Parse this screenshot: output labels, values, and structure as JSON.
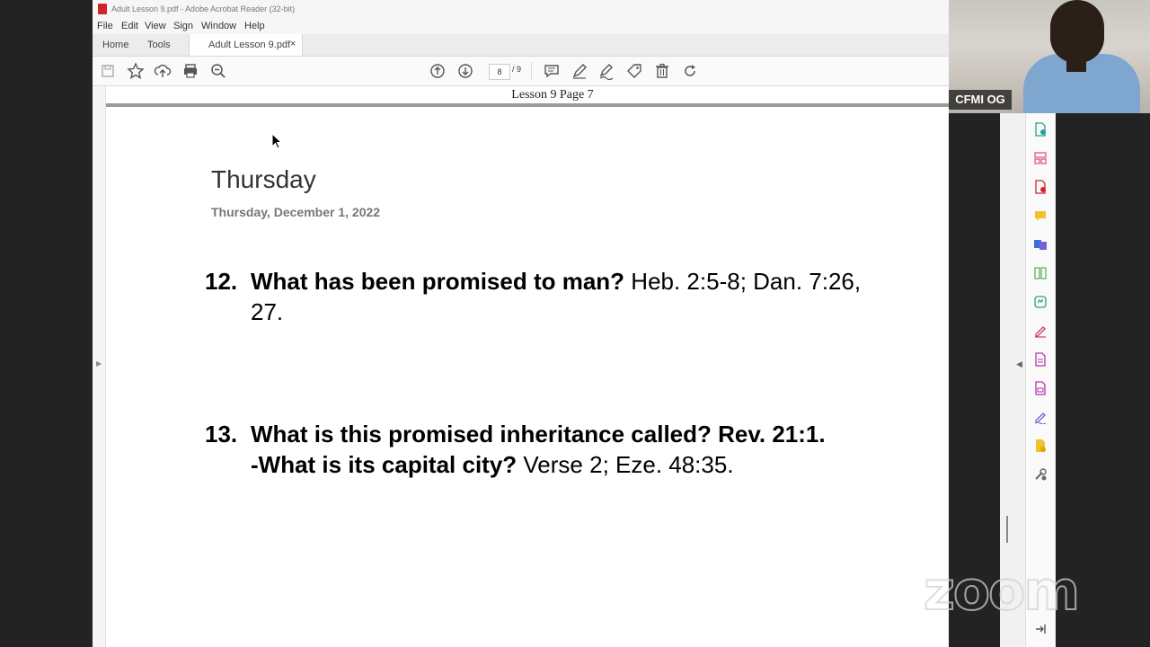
{
  "window": {
    "title": "Adult Lesson 9.pdf - Adobe Acrobat Reader (32-bit)"
  },
  "menu": [
    "File",
    "Edit",
    "View",
    "Sign",
    "Window",
    "Help"
  ],
  "tabs": {
    "home": "Home",
    "tools": "Tools",
    "document": "Adult Lesson 9.pdf",
    "close": "×"
  },
  "toolbar": {
    "current_page": "8",
    "total_pages": "/ 9"
  },
  "document": {
    "page_header": "Lesson 9 Page 7",
    "day": "Thursday",
    "date": "Thursday, December 1, 2022",
    "questions": [
      {
        "number": "12.",
        "question": "What has been promised to man?",
        "reference": " Heb. 2:5-8; Dan. 7:26, 27."
      },
      {
        "number": "13.",
        "question": "What is this promised inheritance called? Rev. 21:1. -What is its capital city?",
        "reference": " Verse 2; Eze. 48:35."
      }
    ]
  },
  "webcam": {
    "participant_name": "CFMI OG"
  },
  "watermark": "zoom",
  "colors": {
    "acrobat_red": "#d2232a",
    "panel_icons": "#d63384"
  }
}
